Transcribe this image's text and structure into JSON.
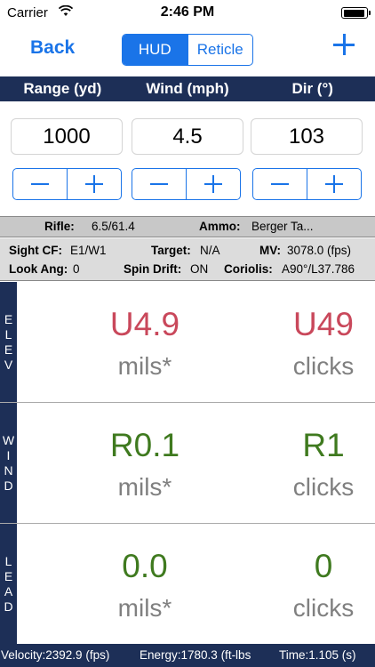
{
  "status_bar": {
    "carrier": "Carrier",
    "time": "2:46 PM"
  },
  "nav": {
    "back_label": "Back",
    "tabs": [
      "HUD",
      "Reticle"
    ],
    "active_tab": "HUD",
    "add_icon": "plus-icon"
  },
  "columns": {
    "range": "Range (yd)",
    "wind": "Wind (mph)",
    "dir": "Dir (°)"
  },
  "inputs": {
    "range": "1000",
    "wind": "4.5",
    "dir": "103"
  },
  "info": {
    "rifle_label": "Rifle:",
    "rifle_value": "6.5/61.4",
    "ammo_label": "Ammo:",
    "ammo_value": "Berger Ta...",
    "sight_label": "Sight CF:",
    "sight_value": "E1/W1",
    "target_label": "Target:",
    "target_value": "N/A",
    "mv_label": "MV:",
    "mv_value": "3078.0 (fps)",
    "look_label": "Look Ang:",
    "look_value": "0",
    "spin_label": "Spin Drift:",
    "spin_value": "ON",
    "coriolis_label": "Coriolis:",
    "coriolis_value": "A90°/L37.786"
  },
  "rows": {
    "elev": {
      "label": [
        "E",
        "L",
        "E",
        "V"
      ],
      "mils": "U4.9",
      "mils_unit": "mils*",
      "clicks": "U49",
      "clicks_unit": "clicks",
      "color": "#c9485b"
    },
    "wind": {
      "label": [
        "W",
        "I",
        "N",
        "D"
      ],
      "mils": "R0.1",
      "mils_unit": "mils*",
      "clicks": "R1",
      "clicks_unit": "clicks",
      "color": "#3f7a1f"
    },
    "lead": {
      "label": [
        "L",
        "E",
        "A",
        "D"
      ],
      "mils": "0.0",
      "mils_unit": "mils*",
      "clicks": "0",
      "clicks_unit": "clicks",
      "color": "#3f7a1f"
    }
  },
  "footer": {
    "velocity": "Velocity:2392.9 (fps)",
    "energy": "Energy:1780.3 (ft-lbs",
    "time": "Time:1.105 (s)"
  },
  "colors": {
    "accent": "#1a74e8",
    "header_bg": "#1d2f57"
  }
}
